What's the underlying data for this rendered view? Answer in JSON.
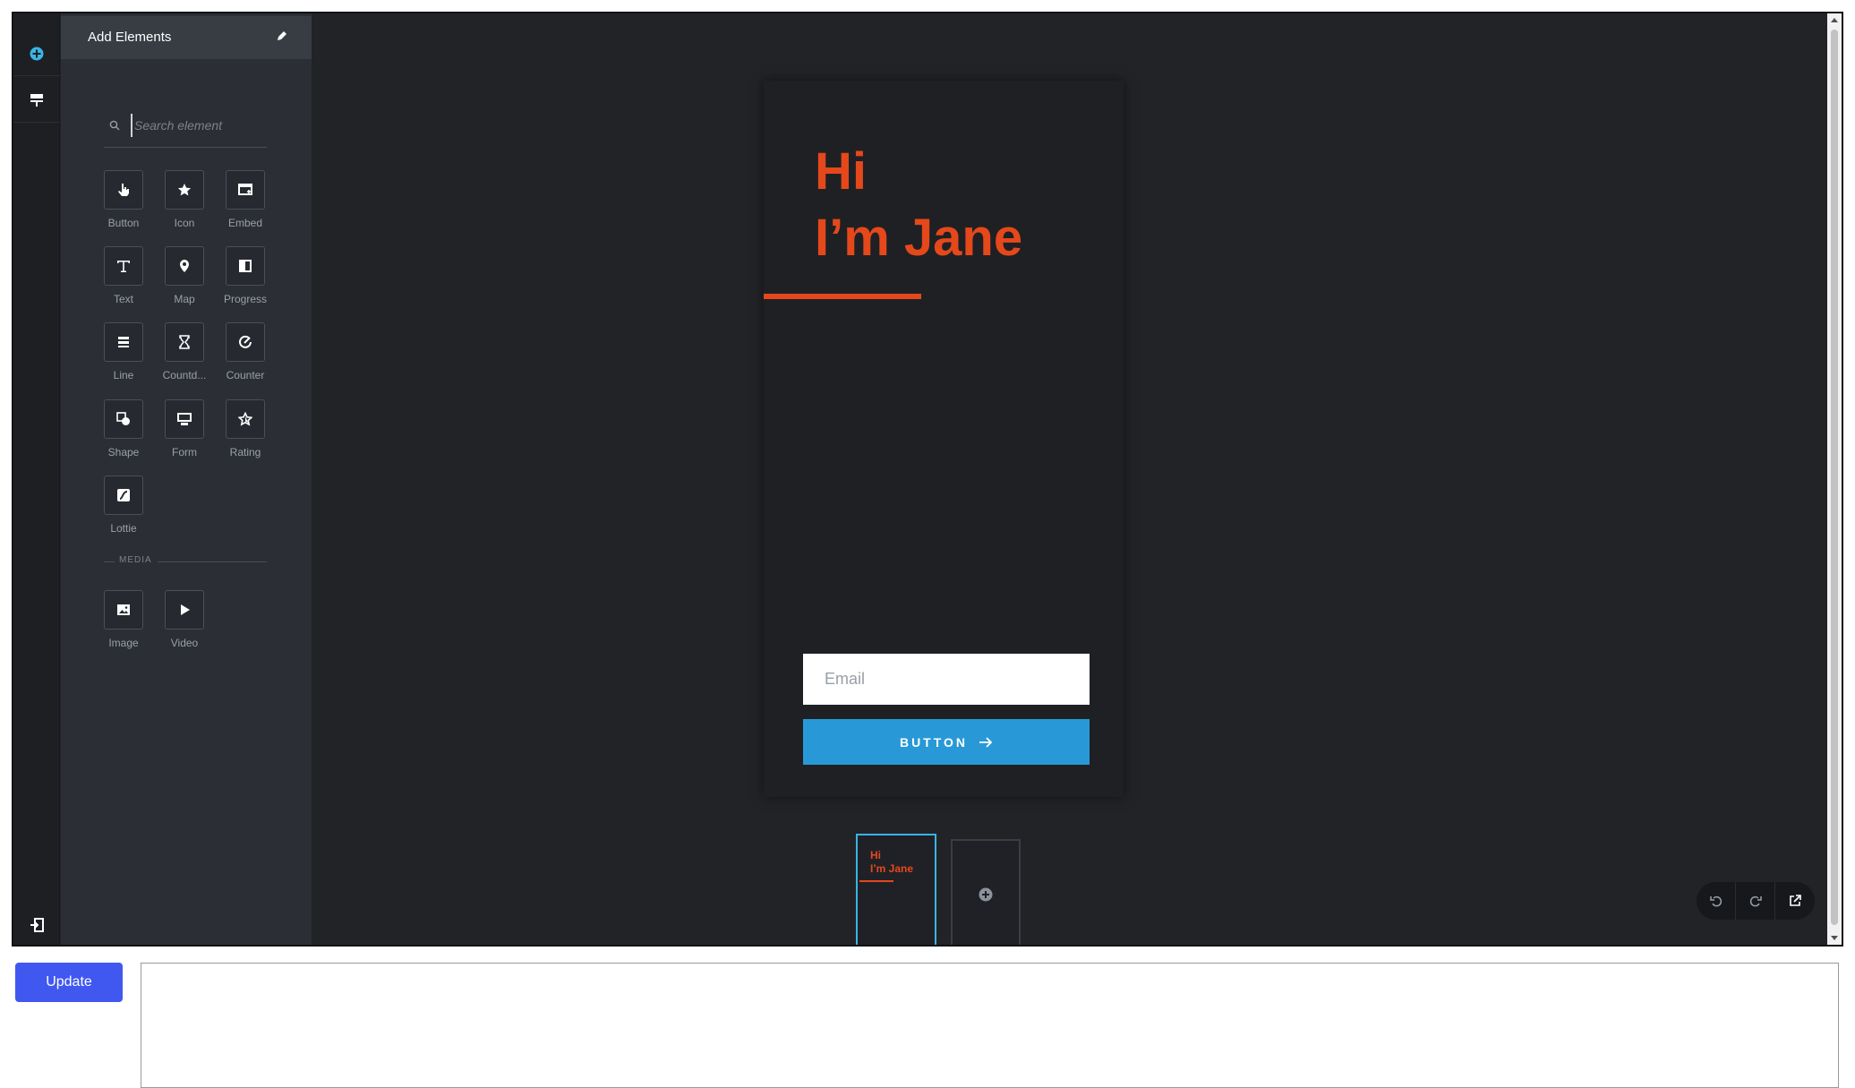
{
  "panel": {
    "title": "Add Elements",
    "search_placeholder": "Search element",
    "elements": [
      "Button",
      "Icon",
      "Embed",
      "Text",
      "Map",
      "Progress",
      "Line",
      "Countd...",
      "Counter",
      "Shape",
      "Form",
      "Rating",
      "Lottie"
    ],
    "media_heading": "MEDIA",
    "media": [
      "Image",
      "Video"
    ]
  },
  "canvas": {
    "hero_line1": "Hi",
    "hero_line2": "I’m Jane",
    "email_placeholder": "Email",
    "button_label": "BUTTON",
    "accent_color": "#e5481b",
    "button_color": "#2899d6"
  },
  "thumbnail": {
    "line1": "Hi",
    "line2": "I’m Jane"
  },
  "footer": {
    "update_label": "Update"
  }
}
